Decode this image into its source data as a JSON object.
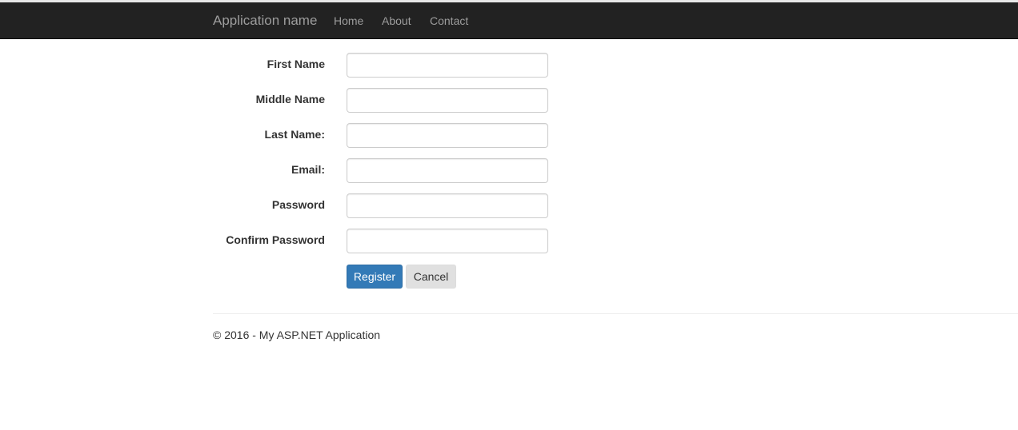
{
  "navbar": {
    "brand": "Application name",
    "links": [
      {
        "label": "Home"
      },
      {
        "label": "About"
      },
      {
        "label": "Contact"
      }
    ]
  },
  "form": {
    "fields": [
      {
        "label": "First Name",
        "value": "",
        "placeholder": ""
      },
      {
        "label": "Middle Name",
        "value": "",
        "placeholder": ""
      },
      {
        "label": "Last Name:",
        "value": "",
        "placeholder": ""
      },
      {
        "label": "Email:",
        "value": "",
        "placeholder": ""
      },
      {
        "label": "Password",
        "value": "",
        "placeholder": ""
      },
      {
        "label": "Confirm Password",
        "value": "",
        "placeholder": ""
      }
    ],
    "register_label": "Register",
    "cancel_label": "Cancel"
  },
  "footer": {
    "text": "© 2016 - My ASP.NET Application"
  },
  "colors": {
    "navbar_bg": "#222222",
    "nav_text": "#9d9d9d",
    "primary_button": "#337ab7",
    "secondary_button": "#e0e0e0"
  }
}
